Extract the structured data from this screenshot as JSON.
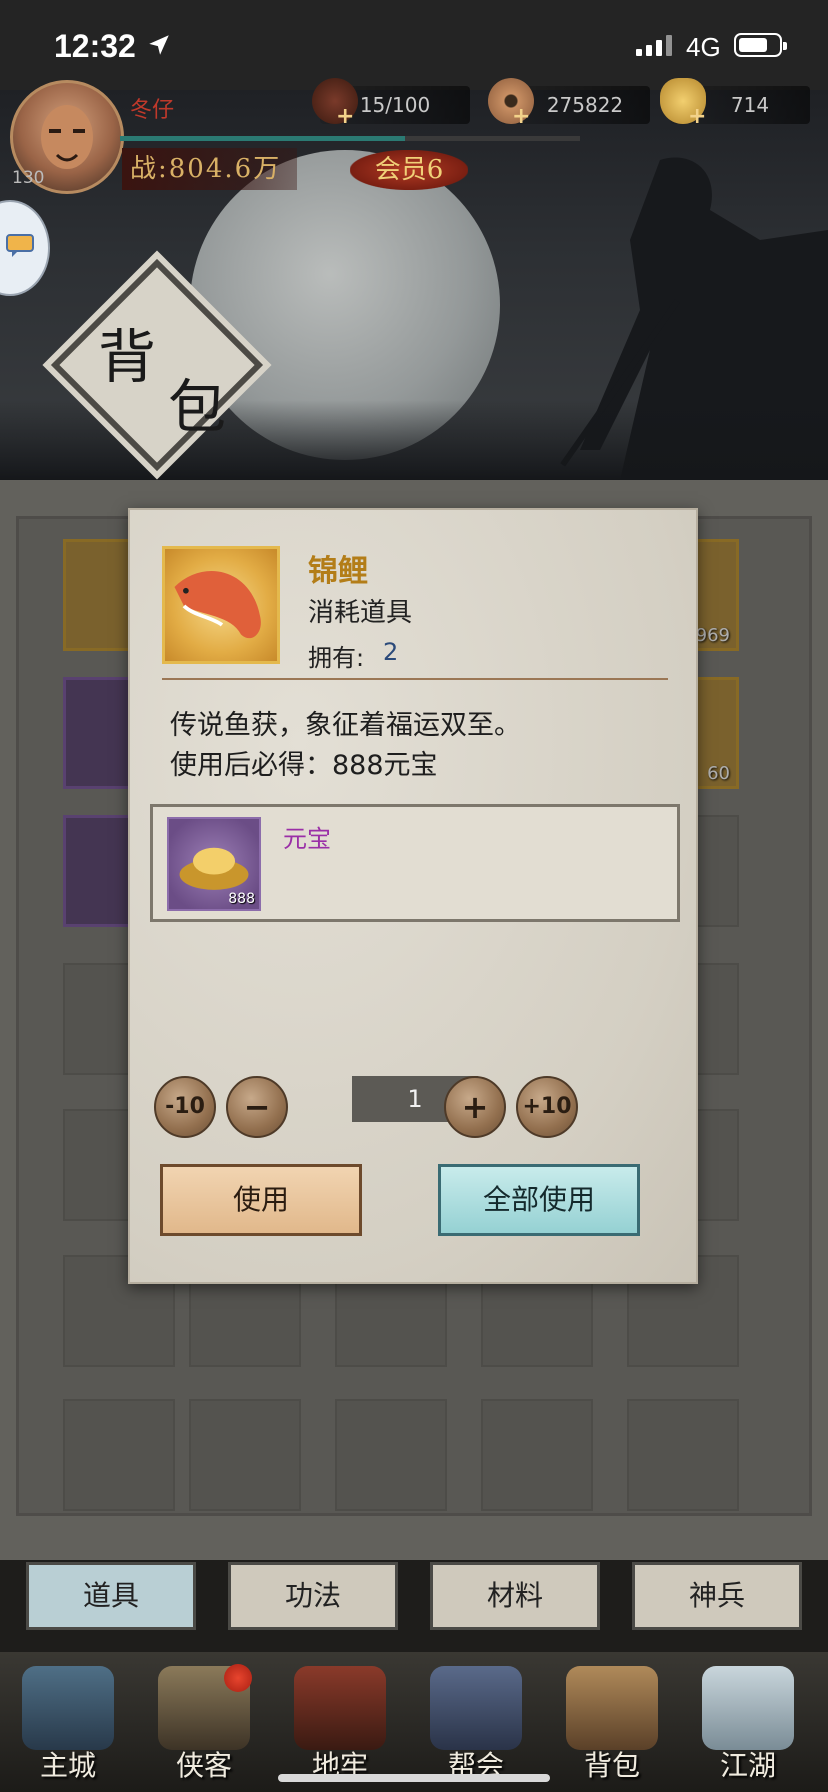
{
  "status_bar": {
    "time": "12:32",
    "network": "4G",
    "icons": [
      "location-arrow-icon",
      "signal-icon",
      "battery-icon"
    ]
  },
  "header": {
    "player_name": "冬仔",
    "level": "130",
    "power": "战:804.6万",
    "vip": "会员6",
    "resources": {
      "stamina": "15/100",
      "copper": "275822",
      "gold": "714"
    }
  },
  "page_title": {
    "char1": "背",
    "char2": "包"
  },
  "inventory": {
    "counts": [
      "969",
      "60"
    ]
  },
  "modal": {
    "item_name": "锦鲤",
    "item_type": "消耗道具",
    "owned_label": "拥有:",
    "owned_value": "2",
    "description_line1": "传说鱼获，象征着福运双至。",
    "description_line2": "使用后必得：888元宝",
    "reward": {
      "name": "元宝",
      "count": "888"
    },
    "quantity": {
      "minus10": "-10",
      "minus": "−",
      "value": "1",
      "plus": "+",
      "plus10": "+10"
    },
    "use_label": "使用",
    "use_all_label": "全部使用"
  },
  "tabs": [
    {
      "label": "道具",
      "active": true
    },
    {
      "label": "功法",
      "active": false
    },
    {
      "label": "材料",
      "active": false
    },
    {
      "label": "神兵",
      "active": false
    }
  ],
  "bottom_nav": [
    {
      "label": "主城"
    },
    {
      "label": "侠客"
    },
    {
      "label": "地牢"
    },
    {
      "label": "帮会"
    },
    {
      "label": "背包"
    },
    {
      "label": "江湖"
    }
  ],
  "colors": {
    "item_name": "#b37d18",
    "reward_name": "#9a2fa7",
    "vip_red": "#b23a24",
    "active_tab": "#b9cfd4"
  }
}
